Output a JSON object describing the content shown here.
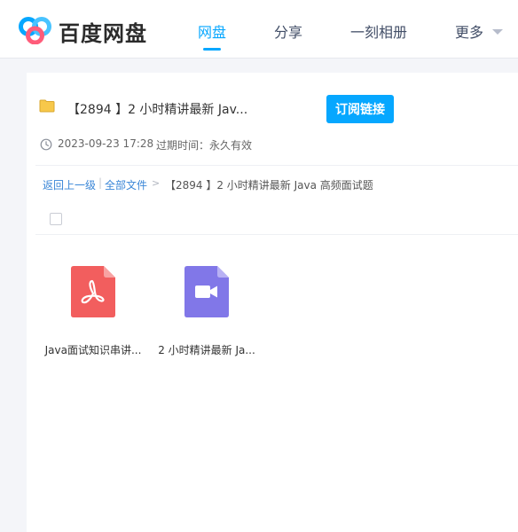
{
  "header": {
    "brand": "百度网盘",
    "nav": [
      {
        "label": "网盘",
        "active": true
      },
      {
        "label": "分享",
        "active": false
      },
      {
        "label": "一刻相册",
        "active": false
      },
      {
        "label": "更多",
        "active": false
      }
    ],
    "accent_color": "#06a7ff"
  },
  "share": {
    "title": "【2894 】2 小时精讲最新 Jav...",
    "subscribe_label": "订阅链接",
    "date": "2023-09-23 17:28",
    "expire": "过期时间：永久有效"
  },
  "breadcrumb": {
    "back": "返回上一级",
    "separator": "|",
    "all_files": "全部文件",
    "arrow": ">",
    "current": "【2894 】2 小时精讲最新 Java 高频面试题"
  },
  "files": [
    {
      "name": "Java面试知识串讲...",
      "icon": "pdf-icon",
      "color": "#f25e5e"
    },
    {
      "name": "2 小时精讲最新 Ja...",
      "icon": "video-icon",
      "color": "#8177e8"
    }
  ]
}
